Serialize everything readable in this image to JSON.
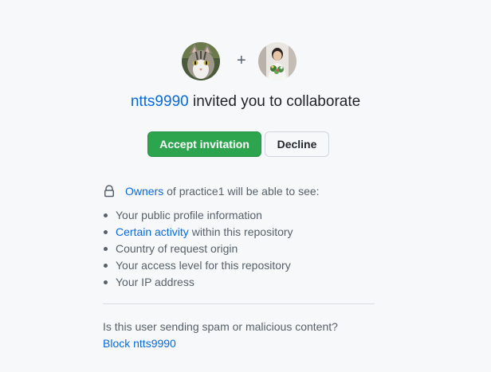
{
  "invitation": {
    "inviter": "ntts9990",
    "title_suffix": " invited you to collaborate",
    "plus": "+"
  },
  "actions": {
    "accept_label": "Accept invitation",
    "decline_label": "Decline"
  },
  "permissions": {
    "owners_link": "Owners",
    "owners_text": " of practice1 will be able to see:",
    "items": [
      {
        "text": "Your public profile information"
      },
      {
        "link": "Certain activity",
        "text": " within this repository"
      },
      {
        "text": "Country of request origin"
      },
      {
        "text": "Your access level for this repository"
      },
      {
        "text": "Your IP address"
      }
    ]
  },
  "spam": {
    "question": "Is this user sending spam or malicious content?",
    "block_label": "Block ntts9990"
  },
  "colors": {
    "accent_link": "#0969da",
    "accept_button": "#2da44e",
    "background": "#f6f8fa"
  },
  "icons": {
    "lock": "lock-icon",
    "plus": "plus-icon"
  }
}
